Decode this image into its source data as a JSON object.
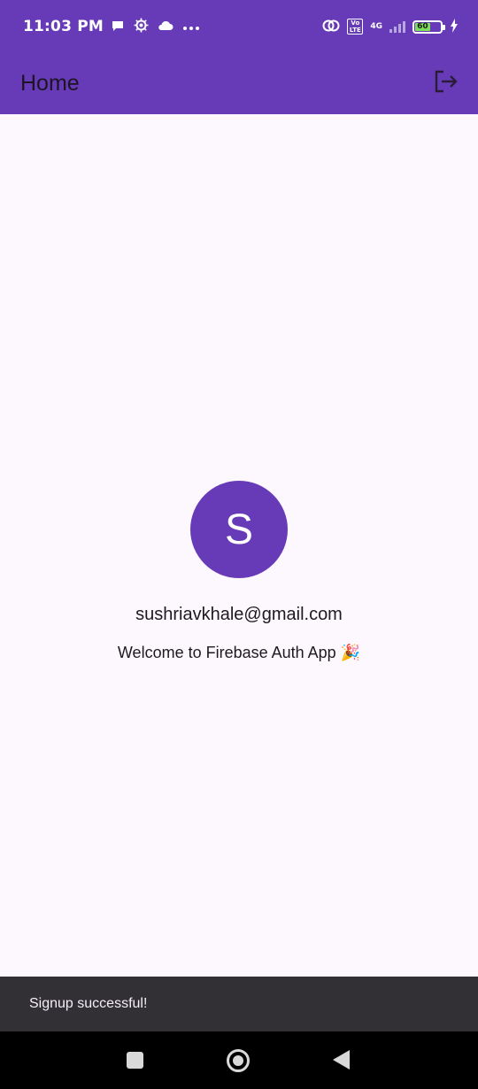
{
  "status_bar": {
    "time": "11:03 PM",
    "left_icons": [
      "chat-bubble-icon",
      "settings-cog-icon",
      "cloud-icon",
      "more-dots-icon"
    ],
    "right_icons": [
      "hotspot-icon",
      "volte-icon",
      "signal-icon",
      "battery-icon",
      "charging-icon"
    ],
    "volte_label": "Vo LTE",
    "network_label": "4G",
    "battery_level": "60"
  },
  "app_bar": {
    "title": "Home",
    "action_icon": "logout-icon"
  },
  "profile": {
    "avatar_initial": "S",
    "email": "sushriavkhale@gmail.com",
    "welcome_text": "Welcome to Firebase Auth App 🎉"
  },
  "snackbar": {
    "message": "Signup successful!"
  },
  "colors": {
    "primary": "#673ab7",
    "background": "#fdf7fe",
    "snackbar": "#322f35"
  }
}
